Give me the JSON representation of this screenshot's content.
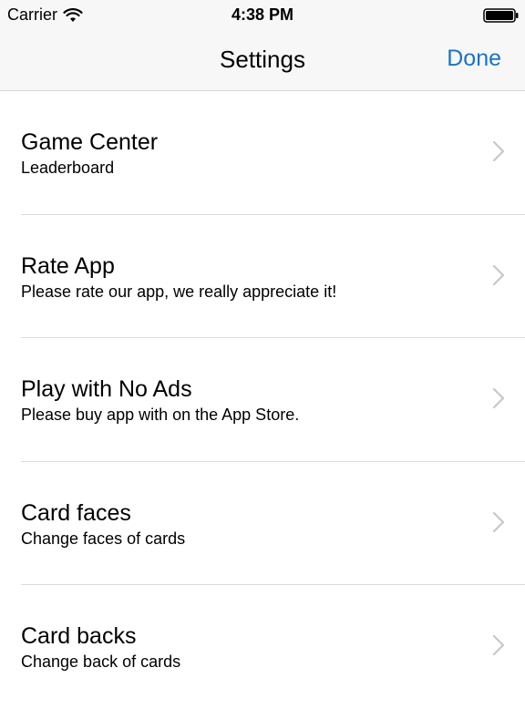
{
  "status_bar": {
    "carrier": "Carrier",
    "time": "4:38 PM",
    "wifi_icon": "wifi-icon",
    "battery_icon": "battery-full-icon"
  },
  "nav": {
    "title": "Settings",
    "done_label": "Done"
  },
  "colors": {
    "accent": "#1a73c9",
    "chevron": "#c7c7cc",
    "header_bg": "#f7f7f7"
  },
  "settings": {
    "items": [
      {
        "title": "Game Center",
        "subtitle": "Leaderboard",
        "icon": "chevron-right-icon"
      },
      {
        "title": "Rate App",
        "subtitle": "Please rate our app, we really appreciate it!",
        "icon": "chevron-right-icon"
      },
      {
        "title": "Play with No Ads",
        "subtitle": "Please buy app with on the App Store.",
        "icon": "chevron-right-icon"
      },
      {
        "title": "Card faces",
        "subtitle": "Change faces of cards",
        "icon": "chevron-right-icon"
      },
      {
        "title": "Card backs",
        "subtitle": "Change back of cards",
        "icon": "chevron-right-icon"
      }
    ]
  }
}
